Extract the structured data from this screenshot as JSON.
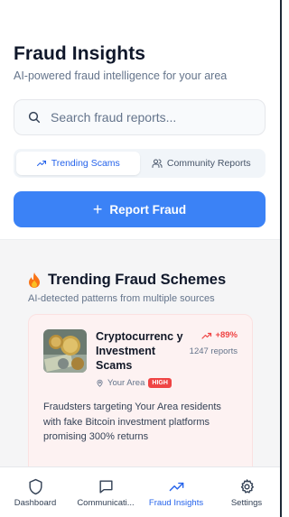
{
  "header": {
    "title": "Fraud Insights",
    "subtitle": "AI-powered fraud intelligence for your area"
  },
  "search": {
    "placeholder": "Search fraud reports..."
  },
  "tabs": [
    {
      "label": "Trending Scams",
      "active": true,
      "icon": "trending-up-icon"
    },
    {
      "label": "Community Reports",
      "active": false,
      "icon": "users-icon"
    }
  ],
  "report_button": {
    "label": "Report Fraud"
  },
  "trending": {
    "title": "Trending Fraud Schemes",
    "subtitle": "AI-detected patterns from multiple sources",
    "cards": [
      {
        "title": "Cryptocurrenc y Investment Scams",
        "location": "Your Area",
        "risk": "HIGH",
        "growth": "+89%",
        "reports": "1247 reports",
        "description": "Fraudsters targeting Your Area residents with fake Bitcoin investment platforms promising 300% returns"
      }
    ]
  },
  "nav": {
    "items": [
      {
        "label": "Dashboard",
        "icon": "shield-icon",
        "active": false
      },
      {
        "label": "Communicati...",
        "icon": "message-icon",
        "active": false
      },
      {
        "label": "Fraud Insights",
        "icon": "trending-up-icon",
        "active": true
      },
      {
        "label": "Settings",
        "icon": "gear-icon",
        "active": false
      }
    ]
  },
  "colors": {
    "accent": "#3b82f6",
    "danger": "#ef4444",
    "active_text": "#2563eb"
  }
}
